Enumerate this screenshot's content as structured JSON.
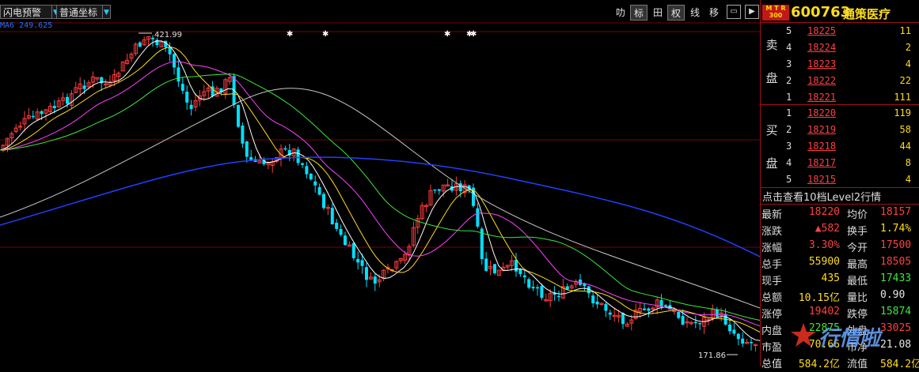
{
  "toolbar": {
    "left_buttons": [
      "闪电预警",
      "普通坐标"
    ],
    "right_buttons": [
      "叻",
      "标",
      "田",
      "权",
      "线",
      "移"
    ],
    "right_active_index": [
      1,
      3
    ]
  },
  "ma_legend": "MA6  249.625",
  "chart_data": {
    "type": "candlestick",
    "high_label": "421.99",
    "low_label": "171.86",
    "ma_colors": [
      "#ffffff",
      "#ffdc1e",
      "#ff40ff",
      "#3ce83c",
      "#c8c8c8",
      "#2040ff"
    ]
  },
  "stock": {
    "logo": "M T R\n300",
    "code": "600763",
    "name": "通策医疗"
  },
  "order_book": {
    "sell_side": "卖\n盘",
    "buy_side": "买\n盘",
    "sell": [
      {
        "i": "5",
        "price": "18225",
        "vol": "11"
      },
      {
        "i": "4",
        "price": "18224",
        "vol": "2"
      },
      {
        "i": "3",
        "price": "18223",
        "vol": "4"
      },
      {
        "i": "2",
        "price": "18222",
        "vol": "22"
      },
      {
        "i": "1",
        "price": "18221",
        "vol": "111"
      }
    ],
    "buy": [
      {
        "i": "1",
        "price": "18220",
        "vol": "119"
      },
      {
        "i": "2",
        "price": "18219",
        "vol": "58"
      },
      {
        "i": "3",
        "price": "18218",
        "vol": "44"
      },
      {
        "i": "4",
        "price": "18217",
        "vol": "8"
      },
      {
        "i": "5",
        "price": "18215",
        "vol": "4"
      }
    ]
  },
  "level2_link": "点击查看10档Level2行情",
  "stats": [
    {
      "l1": "最新",
      "v1": "18220",
      "c1": "red",
      "l2": "均价",
      "v2": "18157",
      "c2": "red"
    },
    {
      "l1": "涨跌",
      "v1": "▲582",
      "c1": "red",
      "l2": "换手",
      "v2": "1.74%",
      "c2": "yel"
    },
    {
      "l1": "涨幅",
      "v1": "3.30%",
      "c1": "red",
      "l2": "今开",
      "v2": "17500",
      "c2": "red"
    },
    {
      "l1": "总手",
      "v1": "55900",
      "c1": "yel",
      "l2": "最高",
      "v2": "18505",
      "c2": "red"
    },
    {
      "l1": "现手",
      "v1": "435",
      "c1": "yel",
      "l2": "最低",
      "v2": "17433",
      "c2": "grn"
    },
    {
      "l1": "总额",
      "v1": "10.15亿",
      "c1": "yel",
      "l2": "量比",
      "v2": "0.90",
      "c2": "wht"
    },
    {
      "l1": "涨停",
      "v1": "19402",
      "c1": "red",
      "l2": "跌停",
      "v2": "15874",
      "c2": "grn"
    },
    {
      "l1": "内盘",
      "v1": "22875",
      "c1": "grn",
      "l2": "外盘",
      "v2": "33025",
      "c2": "red"
    },
    {
      "l1": "市盈",
      "v1": "70.66",
      "c1": "yel",
      "l2": "市净",
      "v2": "21.08",
      "c2": "wht"
    },
    {
      "l1": "总值",
      "v1": "584.2亿",
      "c1": "yel",
      "l2": "流值",
      "v2": "584.2亿",
      "c2": "yel"
    }
  ],
  "watermark": "行情啦"
}
